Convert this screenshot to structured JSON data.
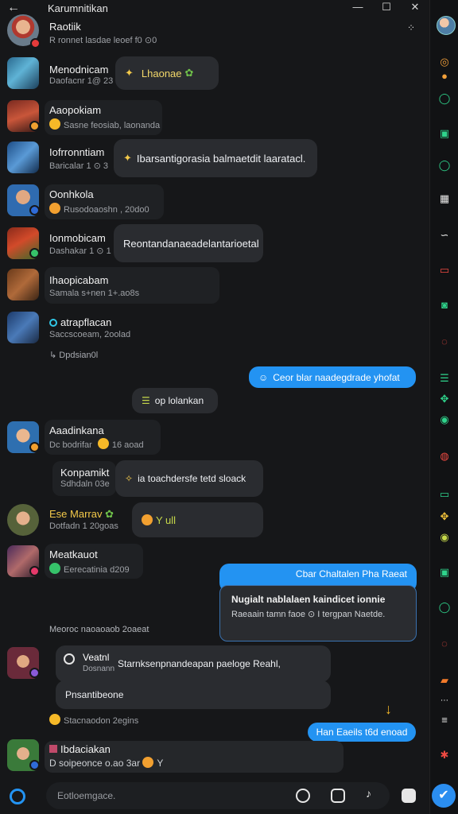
{
  "window": {
    "title": "Karumnitikan",
    "back_icon": "arrow-left-icon",
    "controls": [
      "minimize-icon",
      "maximize-icon",
      "close-icon"
    ]
  },
  "header_chat": {
    "name": "Raotiik",
    "preview": "R ronnet lasdae leoef f0 ⊙0"
  },
  "chats": [
    {
      "name": "Menodnicam",
      "preview": "Daofacnr 1@ 23",
      "bubble": "Lhaonae",
      "bubble_icon": "sparkle-icon"
    },
    {
      "name": "Aaopokiam",
      "preview": "Sasne feosiab, laonanda"
    },
    {
      "name": "Iofrronntiam",
      "preview": "Baricalar 1 ⊙ 3",
      "bubble": "Ibarsantigorasia balmaetdit laaratacl.",
      "bubble_icon": "sparkle-icon"
    },
    {
      "name": "Oonhkola",
      "preview": "Rusodoaoshn , 20do0"
    },
    {
      "name": "Ionmobicam",
      "preview": "Dashakar 1 ⊙ 1",
      "bubble": "Reontandanaeadelantarioetal"
    },
    {
      "name": "Ihaopicabam",
      "preview": "Samala s+nen 1+.ao8s"
    },
    {
      "name": "atrapflacan",
      "preview": "Saccscoeam, 2oolad"
    }
  ],
  "status_line": "Dpdsian0l",
  "outgoing_1": "Ceor blar naadegdrade yhofat",
  "center_chip": "op lolankan",
  "group2": [
    {
      "name": "Aaadinkana",
      "preview": "Dc bodrifar",
      "time": "16 aoad"
    },
    {
      "name": "Konpamikt",
      "preview": "Sdhdaln 03e",
      "bubble": "ia toachdersfe tetd sloack"
    },
    {
      "name": "Ese Marrav",
      "preview": "Dotfadn 1 20goas",
      "bubble": "Y ull"
    },
    {
      "name": "Meatkauot",
      "preview": "Eerecatinia d209"
    }
  ],
  "reply_card": {
    "header": "Cbar Chaltalen Pha Raeat",
    "title": "Nugialt nablalaen kaindicet ionnie",
    "body": "Raeaain tamn faoe ⊙ I tergpan Naetde."
  },
  "date_sep": "Meoroc naoaoaob 2oaeat",
  "thread": {
    "author": "Veatnl",
    "author_sub": "Dosnann",
    "text": "Starnksenpnandeapan paeloge Reahl,",
    "footer": "Pnsantibeone",
    "meta": "Stacnaodon 2egins"
  },
  "outgoing_2": "Han Eaeils t6d enoad",
  "last_chat": {
    "name": "Ibdaciakan",
    "preview": "D soipeonce o.ao 3ar",
    "suffix": "Y"
  },
  "composer": {
    "placeholder": "Eotloemgace."
  },
  "colors": {
    "accent": "#2393f2",
    "bg": "#161719",
    "bubble": "#2a2c30",
    "rail_green": "#2fd48c",
    "rail_orange": "#f2a03a",
    "rail_red": "#ef4a42"
  }
}
